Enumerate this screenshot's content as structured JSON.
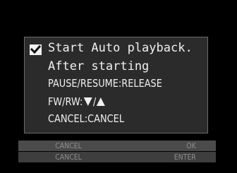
{
  "dialog": {
    "checkbox_checked": true,
    "line1": "Start Auto playback.",
    "line2": "After starting",
    "line3": "PAUSE/RESUME:RELEASE",
    "line4_prefix": "FW/RW:",
    "line4_slash": "/",
    "line5": "CANCEL:CANCEL"
  },
  "softkeys": {
    "row1": {
      "left": "CANCEL",
      "right": "OK"
    },
    "row2": {
      "left": "CANCEL",
      "right": "ENTER"
    }
  },
  "icons": {
    "checkbox": "checkmark-icon",
    "down": "triangle-down-icon",
    "up": "triangle-up-icon"
  },
  "colors": {
    "background": "#000000",
    "dialog": "#2b2b2b",
    "text": "#f0f0f0",
    "softkey_text": "#8e8e8e"
  }
}
